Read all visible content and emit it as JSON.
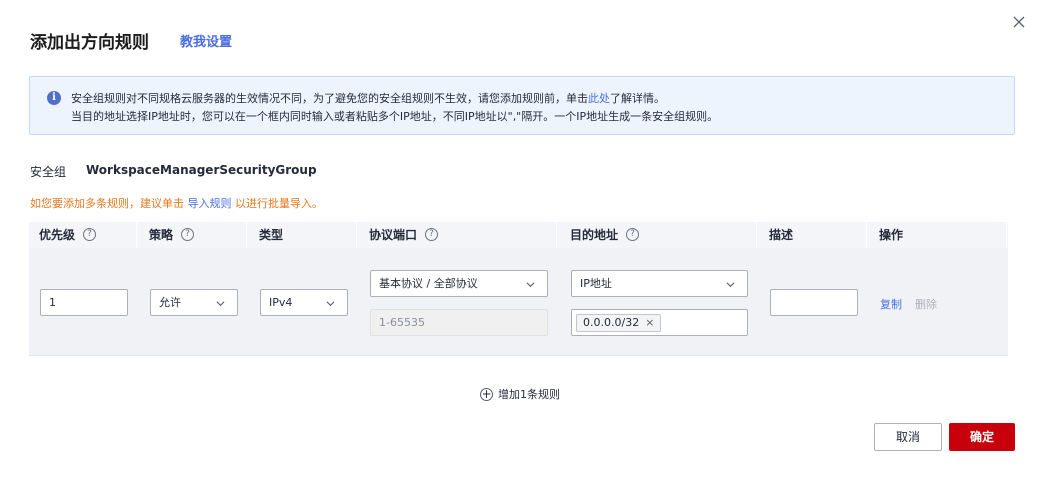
{
  "dialog": {
    "title": "添加出方向规则",
    "guide_link": "教我设置"
  },
  "info": {
    "line1_prefix": "安全组规则对不同规格云服务器的生效情况不同，为了避免您的安全组规则不生效，请您添加规则前，单击",
    "line1_link": "此处",
    "line1_suffix": "了解详情。",
    "line2": "当目的地址选择IP地址时，您可以在一个框内同时输入或者粘贴多个IP地址，不同IP地址以\",\"隔开。一个IP地址生成一条安全组规则。"
  },
  "security_group": {
    "label": "安全组",
    "value": "WorkspaceManagerSecurityGroup"
  },
  "hint": {
    "prefix": "如您要添加多条规则，建议单击 ",
    "link": "导入规则",
    "suffix": " 以进行批量导入。"
  },
  "table": {
    "headers": {
      "priority": "优先级",
      "policy": "策略",
      "type": "类型",
      "protocol_port": "协议端口",
      "destination": "目的地址",
      "description": "描述",
      "operation": "操作"
    },
    "row": {
      "priority": "1",
      "policy": "允许",
      "type": "IPv4",
      "protocol": "基本协议 / 全部协议",
      "port_placeholder": "1-65535",
      "destination_type": "IP地址",
      "destination_tag": "0.0.0.0/32",
      "description": "",
      "copy": "复制",
      "delete": "删除"
    }
  },
  "add_rule": "增加1条规则",
  "buttons": {
    "cancel": "取消",
    "confirm": "确定"
  },
  "colors": {
    "primary": "#c7000b",
    "link": "#4a6ee0",
    "hint": "#e6791e",
    "info_bg": "#eef4fe"
  },
  "icons": [
    "close-icon",
    "info-icon",
    "help-icon",
    "chevron-down-icon",
    "plus-circle-icon"
  ]
}
